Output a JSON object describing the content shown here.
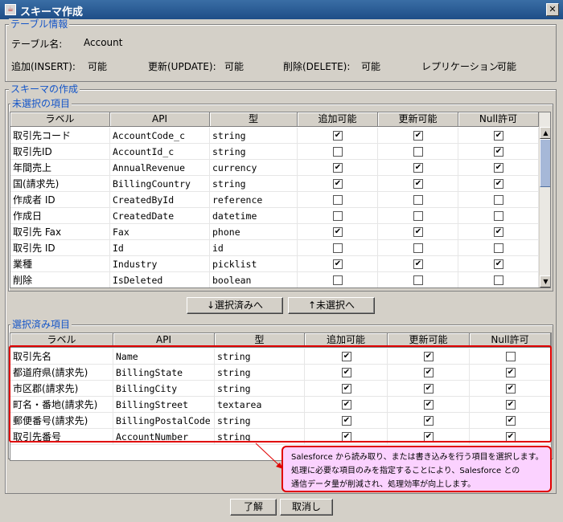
{
  "window": {
    "title": "スキーマ作成",
    "close_symbol": "✕"
  },
  "table_info": {
    "legend": "テーブル情報",
    "name_label": "テーブル名:",
    "name_value": "Account",
    "insert_label": "追加(INSERT):",
    "insert_value": "可能",
    "update_label": "更新(UPDATE):",
    "update_value": "可能",
    "delete_label": "削除(DELETE):",
    "delete_value": "可能",
    "replication_label": "レプリケーション:",
    "replication_value": "可能"
  },
  "schema": {
    "legend": "スキーマの作成",
    "unselected_legend": "未選択の項目",
    "selected_legend": "選択済み項目",
    "columns": [
      "ラベル",
      "API",
      "型",
      "追加可能",
      "更新可能",
      "Null許可"
    ],
    "unselected_rows": [
      {
        "label": "取引先コード",
        "api": "AccountCode_c",
        "type": "string",
        "insert": true,
        "update": true,
        "nullable": true
      },
      {
        "label": "取引先ID",
        "api": "AccountId_c",
        "type": "string",
        "insert": false,
        "update": false,
        "nullable": true
      },
      {
        "label": "年間売上",
        "api": "AnnualRevenue",
        "type": "currency",
        "insert": true,
        "update": true,
        "nullable": true
      },
      {
        "label": "国(請求先)",
        "api": "BillingCountry",
        "type": "string",
        "insert": true,
        "update": true,
        "nullable": true
      },
      {
        "label": "作成者 ID",
        "api": "CreatedById",
        "type": "reference",
        "insert": false,
        "update": false,
        "nullable": false
      },
      {
        "label": "作成日",
        "api": "CreatedDate",
        "type": "datetime",
        "insert": false,
        "update": false,
        "nullable": false
      },
      {
        "label": "取引先 Fax",
        "api": "Fax",
        "type": "phone",
        "insert": true,
        "update": true,
        "nullable": true
      },
      {
        "label": "取引先 ID",
        "api": "Id",
        "type": "id",
        "insert": false,
        "update": false,
        "nullable": false
      },
      {
        "label": "業種",
        "api": "Industry",
        "type": "picklist",
        "insert": true,
        "update": true,
        "nullable": true
      },
      {
        "label": "削除",
        "api": "IsDeleted",
        "type": "boolean",
        "insert": false,
        "update": false,
        "nullable": false
      }
    ],
    "selected_rows": [
      {
        "label": "取引先名",
        "api": "Name",
        "type": "string",
        "insert": true,
        "update": true,
        "nullable": false
      },
      {
        "label": "都道府県(請求先)",
        "api": "BillingState",
        "type": "string",
        "insert": true,
        "update": true,
        "nullable": true
      },
      {
        "label": "市区郡(請求先)",
        "api": "BillingCity",
        "type": "string",
        "insert": true,
        "update": true,
        "nullable": true
      },
      {
        "label": "町名・番地(請求先)",
        "api": "BillingStreet",
        "type": "textarea",
        "insert": true,
        "update": true,
        "nullable": true
      },
      {
        "label": "郵便番号(請求先)",
        "api": "BillingPostalCode",
        "type": "string",
        "insert": true,
        "update": true,
        "nullable": true
      },
      {
        "label": "取引先番号",
        "api": "AccountNumber",
        "type": "string",
        "insert": true,
        "update": true,
        "nullable": true
      }
    ],
    "move_down_label": "↓選択済みへ",
    "move_up_label": "↑未選択へ"
  },
  "callout": {
    "lines": [
      "Salesforce から読み取り、または書き込みを行う項目を選択します。",
      "処理に必要な項目のみを指定することにより、Salesforce との",
      "通信データ量が削減され、処理効率が向上します。"
    ]
  },
  "footer": {
    "ok_label": "了解",
    "cancel_label": "取消し"
  },
  "colors": {
    "legend_text": "#1455c8",
    "highlight": "#e00000",
    "callout_bg": "#fbd2ff"
  }
}
